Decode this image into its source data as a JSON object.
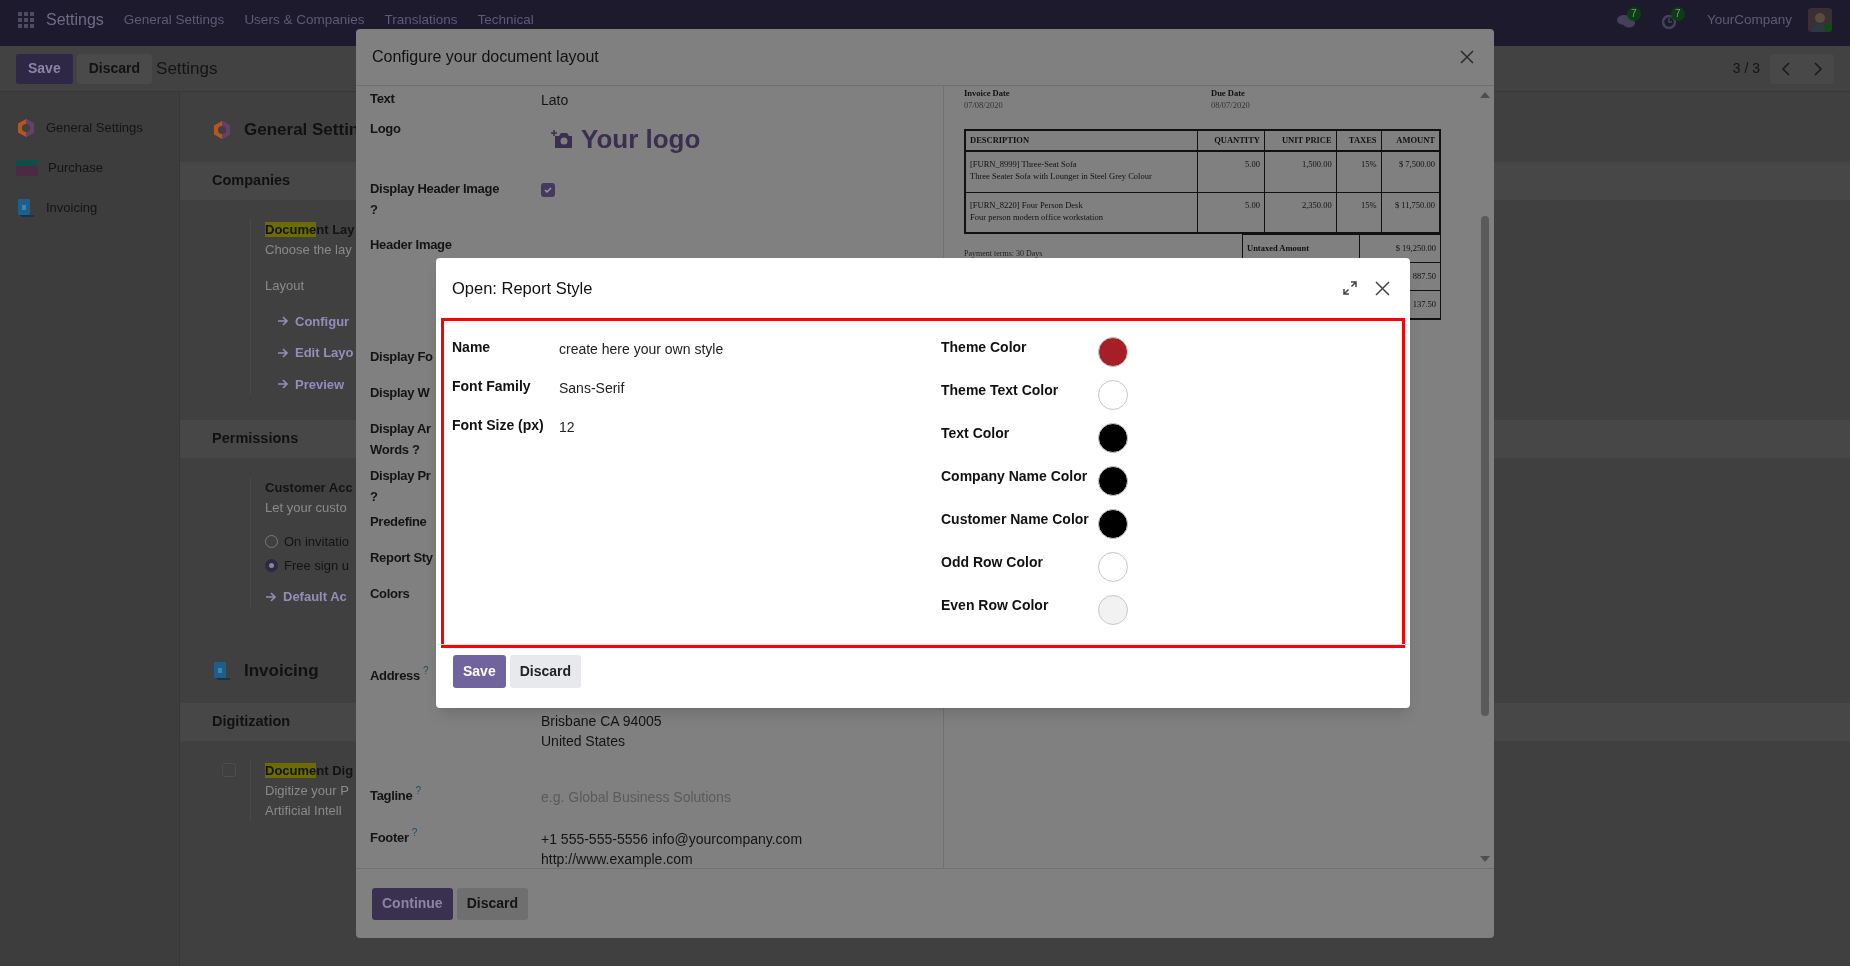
{
  "navbar": {
    "app": "Settings",
    "menu": [
      "General Settings",
      "Users & Companies",
      "Translations",
      "Technical"
    ],
    "chat_badge": "7",
    "activity_badge": "7",
    "company": "YourCompany"
  },
  "control_panel": {
    "buttons": [
      "Save",
      "Discard"
    ],
    "title": "Settings",
    "pager": "3 / 3"
  },
  "sidebar": {
    "items": [
      {
        "label": "General Settings"
      },
      {
        "label": "Purchase"
      },
      {
        "label": "Invoicing"
      }
    ]
  },
  "settings": {
    "blocks": [
      {
        "kind": "app_header",
        "title": "General Settin"
      },
      {
        "kind": "section_header",
        "title": "Companies"
      },
      {
        "kind": "setting",
        "title_highlight": "Docume",
        "title_rest": "nt Lay",
        "description": [
          "Choose the lay"
        ],
        "subheading": "Layout",
        "links": [
          "Configur",
          "Edit Layo",
          "Preview"
        ]
      },
      {
        "kind": "section_header",
        "title": "Permissions"
      },
      {
        "kind": "setting",
        "title": "Customer Acc",
        "description": [
          "Let your custo"
        ],
        "options": [
          {
            "label": "On invitatio",
            "selected": false
          },
          {
            "label": "Free sign u",
            "selected": true
          }
        ],
        "links": [
          "Default Ac"
        ]
      },
      {
        "kind": "app_header",
        "title": "Invoicing"
      },
      {
        "kind": "section_header",
        "title": "Digitization"
      },
      {
        "kind": "setting",
        "checked": false,
        "title_highlight": "Docume",
        "title_rest": "nt Dig",
        "description": [
          "Digitize your P",
          "Artificial Intell"
        ]
      }
    ]
  },
  "layout_dialog": {
    "title": "Configure your document layout",
    "fields": [
      {
        "label": [
          "Text"
        ],
        "value": "Lato"
      },
      {
        "kind": "logo",
        "label": [
          "Logo"
        ],
        "value": "Your logo"
      },
      {
        "kind": "checkbox",
        "label": [
          "Display Header Image",
          "?"
        ],
        "checked": true
      },
      {
        "kind": "image",
        "label": [
          "Header Image"
        ]
      },
      {
        "label": [
          "Display Fo"
        ]
      },
      {
        "label": [
          "Display W"
        ]
      },
      {
        "label": [
          "Display Ar",
          "Words ?"
        ]
      },
      {
        "label": [
          "Display Pr",
          "?"
        ]
      },
      {
        "label": [
          "Predefine"
        ]
      },
      {
        "label": [
          "Report Sty"
        ]
      },
      {
        "kind": "colors",
        "label": [
          "Colors"
        ]
      },
      {
        "kind": "address",
        "label": [
          "Address"
        ],
        "help": "?",
        "lines": [
          "Brisbane CA 94005",
          "United States"
        ]
      },
      {
        "kind": "tagline",
        "label": [
          "Tagline"
        ],
        "help": "?",
        "placeholder": "e.g. Global Business Solutions"
      },
      {
        "kind": "footer",
        "label": [
          "Footer"
        ],
        "help": "?",
        "lines": [
          "+1 555-555-5556 info@yourcompany.com",
          "http://www.example.com"
        ]
      }
    ],
    "preview": {
      "invoice_date_label": "Invoice Date",
      "invoice_date": "07/08/2020",
      "due_date_label": "Due Date",
      "due_date": "08/07/2020",
      "columns": [
        "DESCRIPTION",
        "QUANTITY",
        "UNIT PRICE",
        "TAXES",
        "AMOUNT"
      ],
      "rows": [
        {
          "description": [
            "[FURN_8999] Three-Seat Sofa",
            "Three Seater Sofa with Lounger in Steel Grey Colour"
          ],
          "quantity": "5.00",
          "unit_price": "1,500.00",
          "taxes": "15%",
          "amount": "$ 7,500.00"
        },
        {
          "description": [
            "[FURN_8220] Four Person Desk",
            "Four person modern office workstation"
          ],
          "quantity": "5.00",
          "unit_price": "2,350.00",
          "taxes": "15%",
          "amount": "$ 11,750.00"
        }
      ],
      "payment_terms": "Payment terms: 30 Days",
      "totals": [
        {
          "label": "Untaxed Amount",
          "value": "$ 19,250.00"
        },
        {
          "value": "887.50"
        },
        {
          "value": "137.50"
        }
      ]
    },
    "buttons": [
      "Continue",
      "Discard"
    ]
  },
  "modal": {
    "title": "Open: Report Style",
    "fields": [
      {
        "label": "Name",
        "value": "create here your own style"
      },
      {
        "label": "Font Family",
        "value": "Sans-Serif"
      },
      {
        "label": "Font Size (px)",
        "value": "12"
      }
    ],
    "colors": [
      {
        "label": "Theme Color",
        "color": "#a51f24"
      },
      {
        "label": "Theme Text Color",
        "color": "#ffffff"
      },
      {
        "label": "Text Color",
        "color": "#000000"
      },
      {
        "label": "Company Name Color",
        "color": "#000000"
      },
      {
        "label": "Customer Name Color",
        "color": "#000000"
      },
      {
        "label": "Odd Row Color",
        "color": "#ffffff"
      },
      {
        "label": "Even Row Color",
        "color": "#f2f2f2"
      }
    ],
    "buttons": [
      "Save",
      "Discard"
    ]
  }
}
